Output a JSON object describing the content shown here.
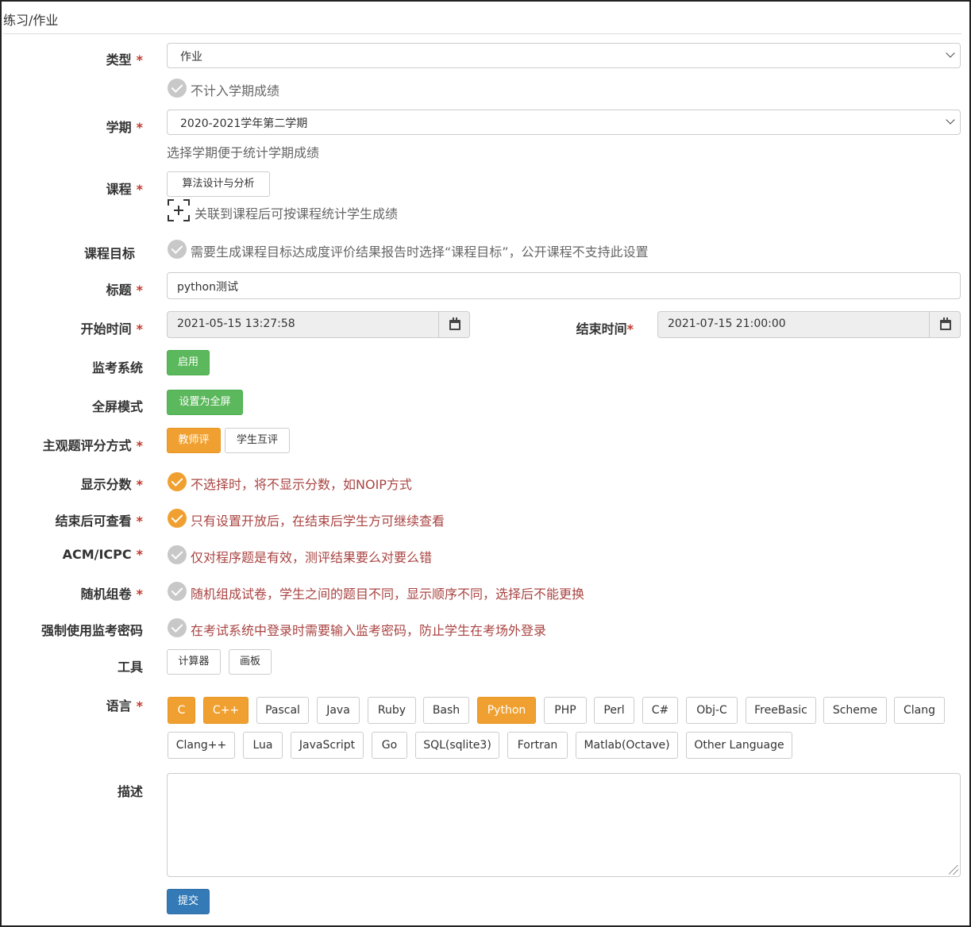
{
  "breadcrumb": "练习/作业",
  "colors": {
    "accent_orange": "#f0a030",
    "green": "#5cb85c",
    "blue": "#337ab7",
    "required_red": "#c0392b",
    "hint_red": "#a94442"
  },
  "form": {
    "type": {
      "label": "类型",
      "value": "作业",
      "checkbox_text": "不计入学期成绩",
      "checkbox_checked": false
    },
    "term": {
      "label": "学期",
      "value": "2020-2021学年第二学期",
      "help": "选择学期便于统计学期成绩"
    },
    "course": {
      "label": "课程",
      "button": "算法设计与分析",
      "help": "关联到课程后可按课程统计学生成绩"
    },
    "course_goal": {
      "label": "课程目标",
      "checkbox_text": "需要生成课程目标达成度评价结果报告时选择“课程目标”，公开课程不支持此设置",
      "checked": false
    },
    "title": {
      "label": "标题",
      "value": "python测试"
    },
    "start_time": {
      "label": "开始时间",
      "value": "2021-05-15 13:27:58"
    },
    "end_time": {
      "label": "结束时间",
      "value": "2021-07-15 21:00:00"
    },
    "proctor": {
      "label": "监考系统",
      "button": "启用"
    },
    "fullscreen": {
      "label": "全屏模式",
      "button": "设置为全屏"
    },
    "grading": {
      "label": "主观题评分方式",
      "options": [
        "教师评",
        "学生互评"
      ],
      "selected": "教师评"
    },
    "show_score": {
      "label": "显示分数",
      "text": "不选择时，将不显示分数，如NOIP方式",
      "checked": true
    },
    "view_after": {
      "label": "结束后可查看",
      "text": "只有设置开放后，在结束后学生方可继续查看",
      "checked": true
    },
    "acm": {
      "label": "ACM/ICPC",
      "text": "仅对程序题是有效，测评结果要么对要么错",
      "checked": false
    },
    "random": {
      "label": "随机组卷",
      "text": "随机组成试卷，学生之间的题目不同，显示顺序不同，选择后不能更换",
      "checked": false
    },
    "force_pwd": {
      "label": "强制使用监考密码",
      "text": "在考试系统中登录时需要输入监考密码，防止学生在考场外登录",
      "checked": false
    },
    "tools": {
      "label": "工具",
      "items": [
        "计算器",
        "画板"
      ]
    },
    "languages": {
      "label": "语言",
      "row1": [
        "C",
        "C++",
        "Pascal",
        "Java",
        "Ruby",
        "Bash",
        "Python",
        "PHP",
        "Perl",
        "C#",
        "Obj-C",
        "FreeBasic",
        "Scheme",
        "Clang"
      ],
      "row2": [
        "Clang++",
        "Lua",
        "JavaScript",
        "Go",
        "SQL(sqlite3)",
        "Fortran",
        "Matlab(Octave)",
        "Other Language"
      ],
      "selected": [
        "C",
        "C++",
        "Python"
      ]
    },
    "description": {
      "label": "描述",
      "value": ""
    },
    "required_mark": "*",
    "submit": "提交"
  }
}
